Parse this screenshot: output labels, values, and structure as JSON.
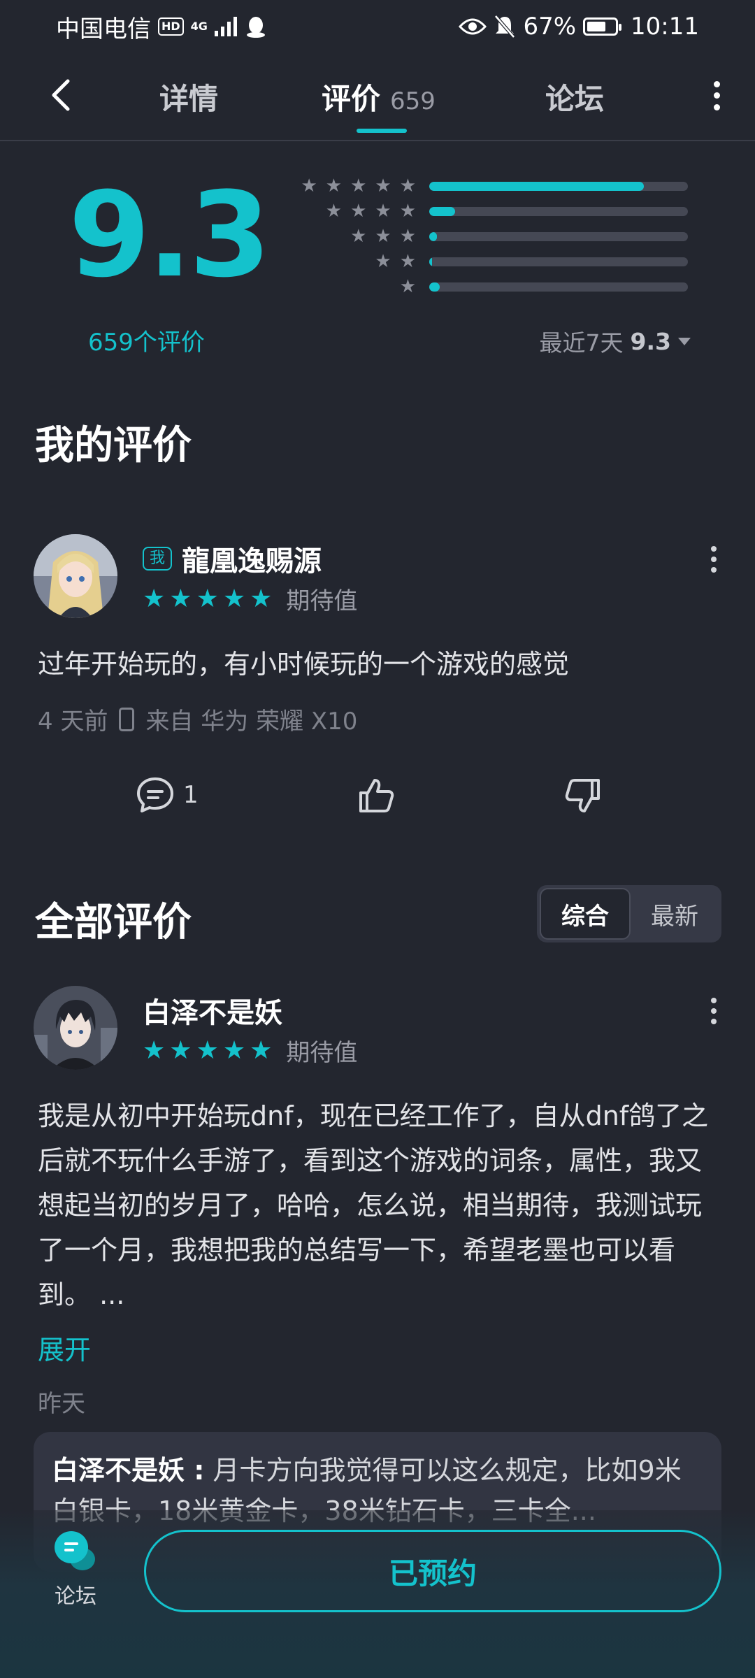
{
  "status_bar": {
    "carrier": "中国电信",
    "hd": "HD",
    "signal": "4G",
    "battery": "67%",
    "time": "10:11"
  },
  "nav": {
    "tabs": [
      {
        "label": "详情"
      },
      {
        "label": "评价",
        "count": "659"
      },
      {
        "label": "论坛"
      }
    ]
  },
  "rating": {
    "score": "9.3",
    "count_label": "659个评价",
    "distribution": [
      {
        "stars": 5,
        "fraction": 0.83
      },
      {
        "stars": 4,
        "fraction": 0.1
      },
      {
        "stars": 3,
        "fraction": 0.03
      },
      {
        "stars": 2,
        "fraction": 0.01
      },
      {
        "stars": 1,
        "fraction": 0.04
      }
    ],
    "recent_label": "最近7天",
    "recent_score": "9.3"
  },
  "my_review": {
    "section_title": "我的评价",
    "badge": "我",
    "username": "龍凰逸赐源",
    "stars": 5,
    "tag": "期待值",
    "text": "过年开始玩的，有小时候玩的一个游戏的感觉",
    "time": "4 天前",
    "device": "来自 华为 荣耀 X10",
    "comment_count": "1"
  },
  "all_reviews": {
    "section_title": "全部评价",
    "sort_options": [
      "综合",
      "最新"
    ],
    "sort_selected": "综合",
    "items": [
      {
        "username": "白泽不是妖",
        "stars": 5,
        "tag": "期待值",
        "text": "我是从初中开始玩dnf，现在已经工作了，自从dnf鸽了之后就不玩什么手游了，看到这个游戏的词条，属性，我又想起当初的岁月了，哈哈，怎么说，相当期待，我测试玩了一个月，我想把我的总结写一下，希望老墨也可以看到。 ...",
        "expand_label": "展开",
        "time": "昨天",
        "reply": {
          "author": "白泽不是妖 :",
          "text": "月卡方向我觉得可以这么规定，比如9米白银卡，18米黄金卡，38米钻石卡，三卡全..."
        }
      }
    ]
  },
  "bottom_bar": {
    "forum_label": "论坛",
    "reserve_label": "已预约"
  },
  "colors": {
    "accent": "#14c2cc",
    "background": "#23262f"
  }
}
